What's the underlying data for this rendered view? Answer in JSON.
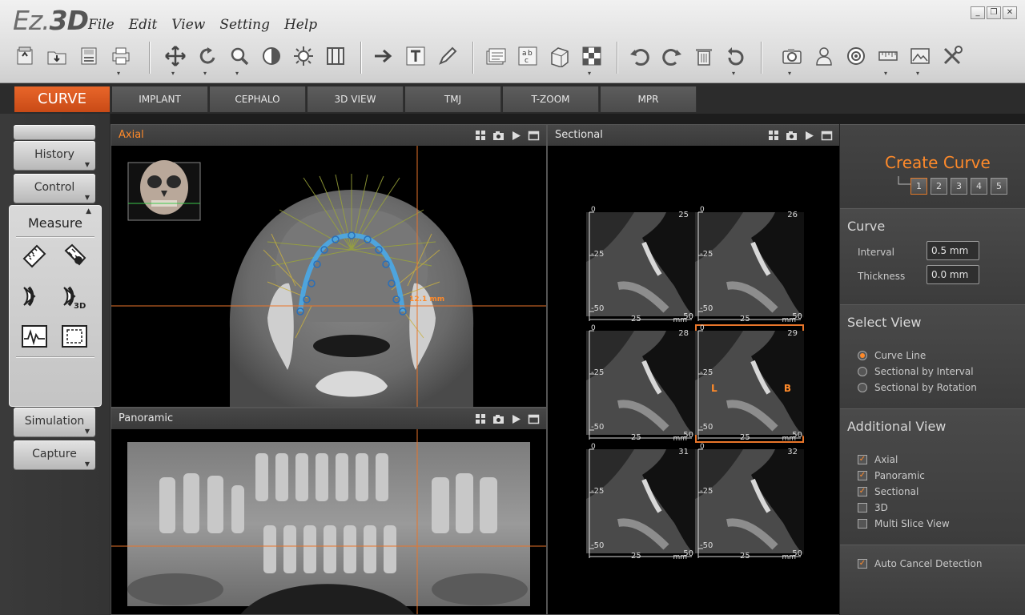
{
  "app": {
    "logo_main": "Ez.",
    "logo_bold": "3D"
  },
  "menu": [
    "File",
    "Edit",
    "View",
    "Setting",
    "Help"
  ],
  "window_controls": [
    "_",
    "❐",
    "✕"
  ],
  "tabs": [
    {
      "label": "CURVE",
      "active": true
    },
    {
      "label": "IMPLANT"
    },
    {
      "label": "CEPHALO"
    },
    {
      "label": "3D VIEW"
    },
    {
      "label": "TMJ"
    },
    {
      "label": "T-ZOOM"
    },
    {
      "label": "MPR"
    }
  ],
  "left": {
    "history": "History",
    "control": "Control",
    "measure_title": "Measure",
    "simulation": "Simulation",
    "capture": "Capture"
  },
  "viewports": {
    "axial": {
      "title": "Axial",
      "measurement": "12.1 mm"
    },
    "panoramic": {
      "title": "Panoramic"
    },
    "sectional": {
      "title": "Sectional",
      "cells": [
        {
          "num": "25",
          "x_labels": [
            "25",
            "50"
          ],
          "y_labels": [
            "0",
            "-25",
            "-50"
          ],
          "unit": "mm"
        },
        {
          "num": "26",
          "x_labels": [
            "25",
            "50"
          ],
          "y_labels": [
            "0",
            "-25",
            "-50"
          ],
          "unit": "mm"
        },
        {
          "num": "28",
          "x_labels": [
            "25",
            "50"
          ],
          "y_labels": [
            "0",
            "-25",
            "-50"
          ],
          "unit": "mm"
        },
        {
          "num": "29",
          "x_labels": [
            "25",
            "50"
          ],
          "y_labels": [
            "0",
            "-25",
            "-50"
          ],
          "unit": "mm",
          "active": true,
          "left_mark": "L",
          "right_mark": "B"
        },
        {
          "num": "31",
          "x_labels": [
            "25",
            "50"
          ],
          "y_labels": [
            "0",
            "-25",
            "-50"
          ],
          "unit": "mm"
        },
        {
          "num": "32",
          "x_labels": [
            "25",
            "50"
          ],
          "y_labels": [
            "0",
            "-25",
            "-50"
          ],
          "unit": "mm"
        }
      ]
    }
  },
  "right": {
    "create_curve": "Create Curve",
    "steps": [
      "1",
      "2",
      "3",
      "4",
      "5"
    ],
    "curve": {
      "title": "Curve",
      "interval_label": "Interval",
      "interval_value": "0.5 mm",
      "thickness_label": "Thickness",
      "thickness_value": "0.0 mm"
    },
    "select_view": {
      "title": "Select View",
      "options": [
        "Curve Line",
        "Sectional by Interval",
        "Sectional by Rotation"
      ],
      "selected": 0
    },
    "additional_view": {
      "title": "Additional View",
      "options": [
        {
          "label": "Axial",
          "checked": true
        },
        {
          "label": "Panoramic",
          "checked": true
        },
        {
          "label": "Sectional",
          "checked": true
        },
        {
          "label": "3D",
          "checked": false
        },
        {
          "label": "Multi Slice View",
          "checked": false
        }
      ]
    },
    "auto_cancel": {
      "label": "Auto Cancel Detection",
      "checked": true
    }
  },
  "colors": {
    "accent": "#ff8a2a",
    "tab_active": "#d4551c"
  }
}
